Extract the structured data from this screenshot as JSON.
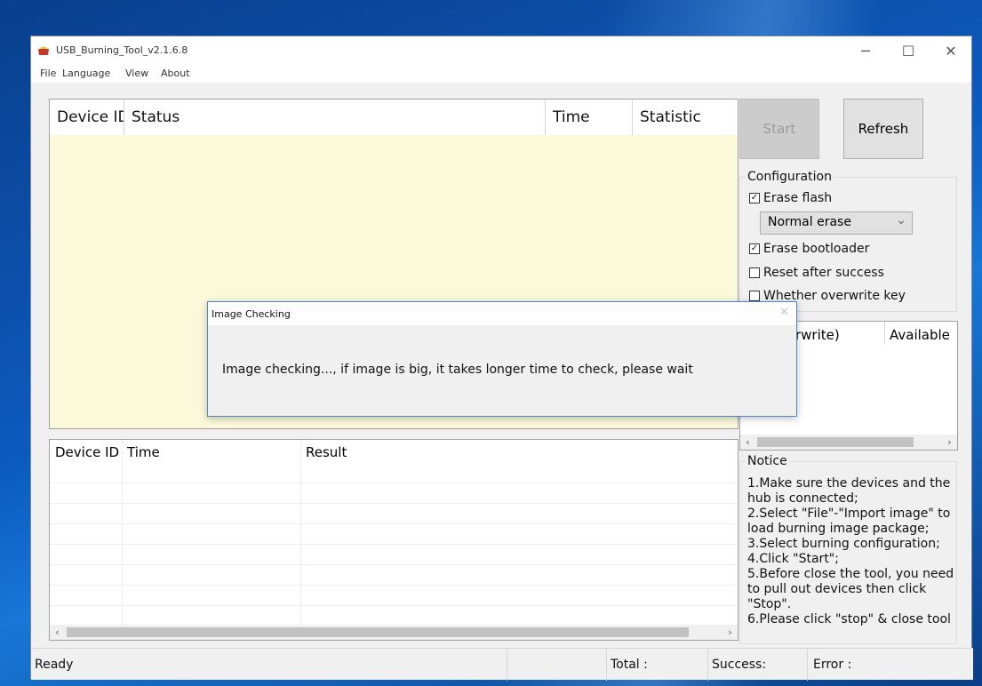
{
  "window": {
    "title": "USB_Burning_Tool_v2.1.6.8",
    "controls": {
      "minimize": "─",
      "maximize": "☐",
      "close": "✕"
    }
  },
  "menu": [
    "File",
    "Language",
    "View",
    "About"
  ],
  "device_table": {
    "columns": [
      "Device ID",
      "Status",
      "Time",
      "Statistic"
    ],
    "bg_color": "#fbf9d9"
  },
  "buttons": {
    "start": "Start",
    "refresh": "Refresh"
  },
  "configuration": {
    "title": "Configuration",
    "erase_flash": {
      "label": "Erase flash",
      "checked": true
    },
    "erase_mode": "Normal erase",
    "erase_bootloader": {
      "label": "Erase bootloader",
      "checked": true
    },
    "reset_after_success": {
      "label": "Reset after success",
      "checked": false
    },
    "overwrite_key": {
      "label": "Whether overwrite key",
      "checked": false
    }
  },
  "key_table": {
    "columns": [
      "rwrite)",
      "Available"
    ]
  },
  "result_table": {
    "columns": [
      "Device ID",
      "Time",
      "Result"
    ]
  },
  "notice": {
    "title": "Notice",
    "lines": [
      "1.Make sure the devices and the hub is connected;",
      "2.Select \"File\"-\"Import image\" to load burning image package;",
      "3.Select burning configuration;",
      "4.Click \"Start\";",
      "5.Before close the tool, you need to pull out devices then click \"Stop\".",
      "6.Please click \"stop\" & close tool"
    ]
  },
  "statusbar": {
    "ready": "Ready",
    "total": "Total :",
    "success": "Success:",
    "error": "Error :"
  },
  "dialog": {
    "title": "Image Checking",
    "close": "✕",
    "message": "Image checking..., if image is big, it takes longer time to check, please wait"
  },
  "glyphs": {
    "arrow_left": "‹",
    "arrow_right": "›",
    "dropdown": "⌄",
    "check": "✓"
  }
}
